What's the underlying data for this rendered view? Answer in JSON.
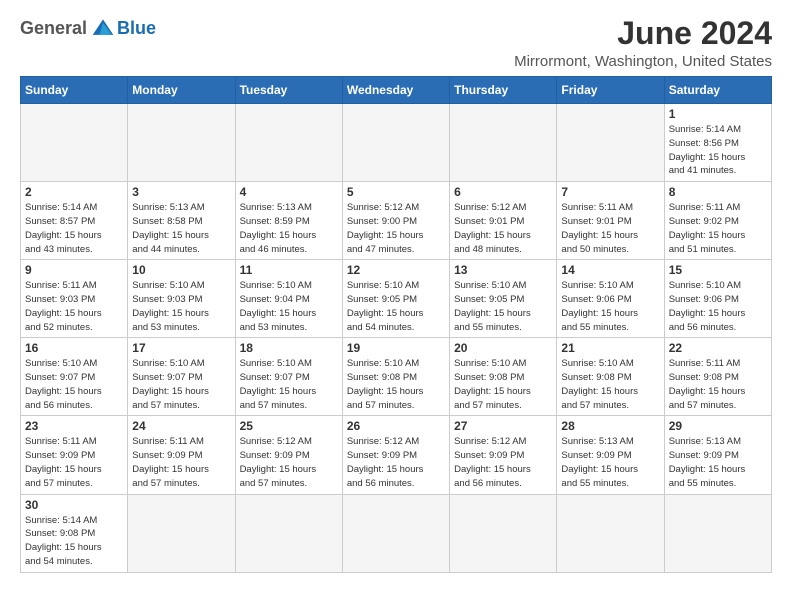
{
  "logo": {
    "general": "General",
    "blue": "Blue"
  },
  "title": "June 2024",
  "location": "Mirrormont, Washington, United States",
  "days_of_week": [
    "Sunday",
    "Monday",
    "Tuesday",
    "Wednesday",
    "Thursday",
    "Friday",
    "Saturday"
  ],
  "weeks": [
    [
      {
        "day": "",
        "info": ""
      },
      {
        "day": "",
        "info": ""
      },
      {
        "day": "",
        "info": ""
      },
      {
        "day": "",
        "info": ""
      },
      {
        "day": "",
        "info": ""
      },
      {
        "day": "",
        "info": ""
      },
      {
        "day": "1",
        "info": "Sunrise: 5:14 AM\nSunset: 8:56 PM\nDaylight: 15 hours\nand 41 minutes."
      }
    ],
    [
      {
        "day": "2",
        "info": "Sunrise: 5:14 AM\nSunset: 8:57 PM\nDaylight: 15 hours\nand 43 minutes."
      },
      {
        "day": "3",
        "info": "Sunrise: 5:13 AM\nSunset: 8:58 PM\nDaylight: 15 hours\nand 44 minutes."
      },
      {
        "day": "4",
        "info": "Sunrise: 5:13 AM\nSunset: 8:59 PM\nDaylight: 15 hours\nand 46 minutes."
      },
      {
        "day": "5",
        "info": "Sunrise: 5:12 AM\nSunset: 9:00 PM\nDaylight: 15 hours\nand 47 minutes."
      },
      {
        "day": "6",
        "info": "Sunrise: 5:12 AM\nSunset: 9:01 PM\nDaylight: 15 hours\nand 48 minutes."
      },
      {
        "day": "7",
        "info": "Sunrise: 5:11 AM\nSunset: 9:01 PM\nDaylight: 15 hours\nand 50 minutes."
      },
      {
        "day": "8",
        "info": "Sunrise: 5:11 AM\nSunset: 9:02 PM\nDaylight: 15 hours\nand 51 minutes."
      }
    ],
    [
      {
        "day": "9",
        "info": "Sunrise: 5:11 AM\nSunset: 9:03 PM\nDaylight: 15 hours\nand 52 minutes."
      },
      {
        "day": "10",
        "info": "Sunrise: 5:10 AM\nSunset: 9:03 PM\nDaylight: 15 hours\nand 53 minutes."
      },
      {
        "day": "11",
        "info": "Sunrise: 5:10 AM\nSunset: 9:04 PM\nDaylight: 15 hours\nand 53 minutes."
      },
      {
        "day": "12",
        "info": "Sunrise: 5:10 AM\nSunset: 9:05 PM\nDaylight: 15 hours\nand 54 minutes."
      },
      {
        "day": "13",
        "info": "Sunrise: 5:10 AM\nSunset: 9:05 PM\nDaylight: 15 hours\nand 55 minutes."
      },
      {
        "day": "14",
        "info": "Sunrise: 5:10 AM\nSunset: 9:06 PM\nDaylight: 15 hours\nand 55 minutes."
      },
      {
        "day": "15",
        "info": "Sunrise: 5:10 AM\nSunset: 9:06 PM\nDaylight: 15 hours\nand 56 minutes."
      }
    ],
    [
      {
        "day": "16",
        "info": "Sunrise: 5:10 AM\nSunset: 9:07 PM\nDaylight: 15 hours\nand 56 minutes."
      },
      {
        "day": "17",
        "info": "Sunrise: 5:10 AM\nSunset: 9:07 PM\nDaylight: 15 hours\nand 57 minutes."
      },
      {
        "day": "18",
        "info": "Sunrise: 5:10 AM\nSunset: 9:07 PM\nDaylight: 15 hours\nand 57 minutes."
      },
      {
        "day": "19",
        "info": "Sunrise: 5:10 AM\nSunset: 9:08 PM\nDaylight: 15 hours\nand 57 minutes."
      },
      {
        "day": "20",
        "info": "Sunrise: 5:10 AM\nSunset: 9:08 PM\nDaylight: 15 hours\nand 57 minutes."
      },
      {
        "day": "21",
        "info": "Sunrise: 5:10 AM\nSunset: 9:08 PM\nDaylight: 15 hours\nand 57 minutes."
      },
      {
        "day": "22",
        "info": "Sunrise: 5:11 AM\nSunset: 9:08 PM\nDaylight: 15 hours\nand 57 minutes."
      }
    ],
    [
      {
        "day": "23",
        "info": "Sunrise: 5:11 AM\nSunset: 9:09 PM\nDaylight: 15 hours\nand 57 minutes."
      },
      {
        "day": "24",
        "info": "Sunrise: 5:11 AM\nSunset: 9:09 PM\nDaylight: 15 hours\nand 57 minutes."
      },
      {
        "day": "25",
        "info": "Sunrise: 5:12 AM\nSunset: 9:09 PM\nDaylight: 15 hours\nand 57 minutes."
      },
      {
        "day": "26",
        "info": "Sunrise: 5:12 AM\nSunset: 9:09 PM\nDaylight: 15 hours\nand 56 minutes."
      },
      {
        "day": "27",
        "info": "Sunrise: 5:12 AM\nSunset: 9:09 PM\nDaylight: 15 hours\nand 56 minutes."
      },
      {
        "day": "28",
        "info": "Sunrise: 5:13 AM\nSunset: 9:09 PM\nDaylight: 15 hours\nand 55 minutes."
      },
      {
        "day": "29",
        "info": "Sunrise: 5:13 AM\nSunset: 9:09 PM\nDaylight: 15 hours\nand 55 minutes."
      }
    ],
    [
      {
        "day": "30",
        "info": "Sunrise: 5:14 AM\nSunset: 9:08 PM\nDaylight: 15 hours\nand 54 minutes."
      },
      {
        "day": "",
        "info": ""
      },
      {
        "day": "",
        "info": ""
      },
      {
        "day": "",
        "info": ""
      },
      {
        "day": "",
        "info": ""
      },
      {
        "day": "",
        "info": ""
      },
      {
        "day": "",
        "info": ""
      }
    ]
  ]
}
